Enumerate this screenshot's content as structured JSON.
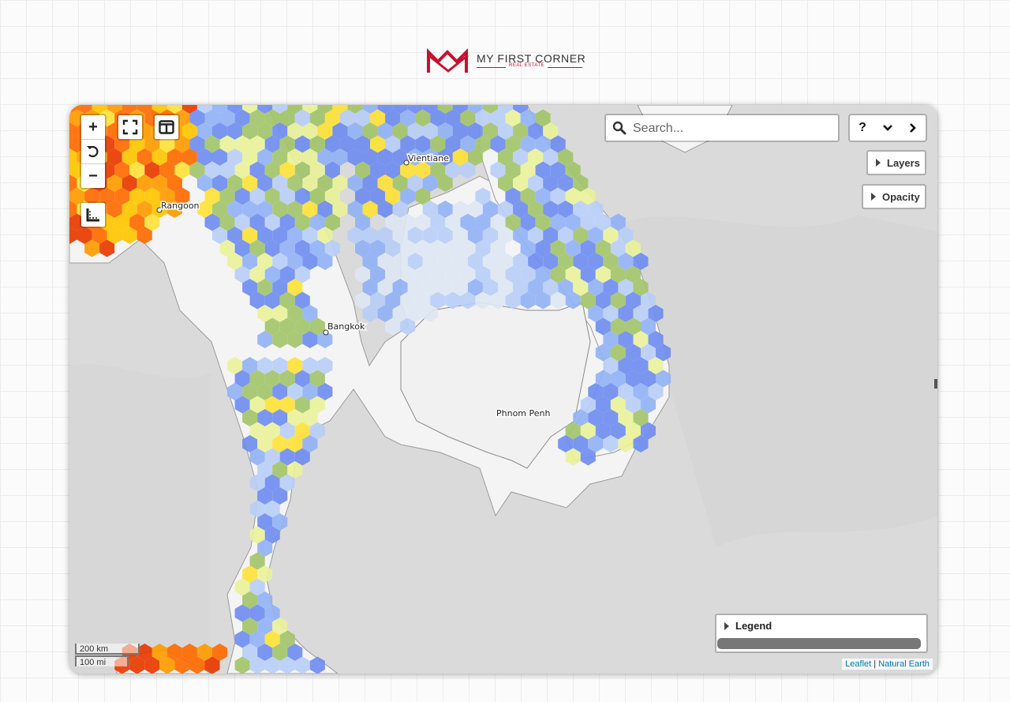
{
  "brand": {
    "name": "MY FIRST CORNER",
    "subtitle": "REAL ESTATE",
    "color": "#c8102e"
  },
  "map": {
    "search": {
      "placeholder": "Search..."
    },
    "controls": {
      "zoom_in": "+",
      "zoom_out": "−",
      "reset_icon": "reset-view-icon",
      "fullscreen_icon": "fullscreen-icon",
      "split_icon": "split-view-icon",
      "measure_icon": "ruler-icon"
    },
    "nav": {
      "help": "?",
      "collapse_icon": "chevron-down-icon",
      "next_icon": "chevron-right-icon"
    },
    "panels": {
      "layers": "Layers",
      "opacity": "Opacity",
      "legend": "Legend"
    },
    "scale": {
      "km": "200 km",
      "mi": "100 mi"
    },
    "attribution": {
      "leaflet": "Leaflet",
      "separator": "|",
      "natural_earth": "Natural Earth"
    },
    "cities": [
      {
        "name": "Vientiane"
      },
      {
        "name": "Rangoon"
      },
      {
        "name": "Bangkok"
      },
      {
        "name": "Phnom Penh"
      }
    ],
    "hex_palette": [
      "#dde7f2",
      "#b9cef7",
      "#93b2f5",
      "#6f8df0",
      "#a3c46a",
      "#e9f29a",
      "#ffe23a",
      "#ffc400",
      "#ff9b00",
      "#ff6a00",
      "#e83a00"
    ]
  }
}
